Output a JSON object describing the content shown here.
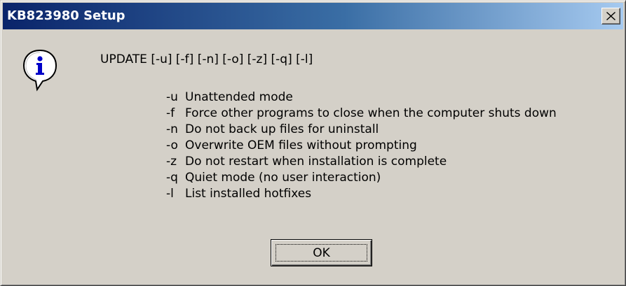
{
  "window": {
    "title": "KB823980 Setup",
    "close_glyph": "✕",
    "icon": "info-icon"
  },
  "message": {
    "usage": "UPDATE [-u] [-f] [-n] [-o] [-z] [-q] [-l]",
    "options": [
      {
        "flag": "-u",
        "description": "Unattended mode"
      },
      {
        "flag": "-f",
        "description": "Force other programs to close when the computer shuts down"
      },
      {
        "flag": "-n",
        "description": "Do not back up files for uninstall"
      },
      {
        "flag": "-o",
        "description": "Overwrite OEM files without prompting"
      },
      {
        "flag": "-z",
        "description": "Do not restart when installation is complete"
      },
      {
        "flag": "-q",
        "description": "Quiet mode (no user interaction)"
      },
      {
        "flag": "-l",
        "description": "List installed hotfixes"
      }
    ]
  },
  "buttons": {
    "ok_label": "OK"
  },
  "colors": {
    "titlebar_start": "#0a246a",
    "titlebar_end": "#a6caf0",
    "face": "#d4d0c8"
  }
}
